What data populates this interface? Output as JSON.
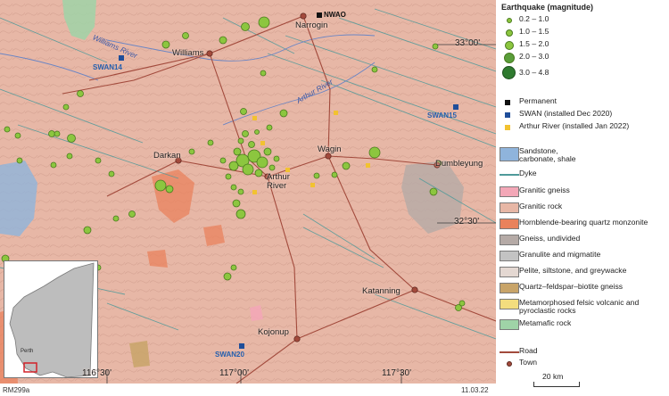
{
  "map": {
    "coordinates": {
      "lat_33_00": "33°00'",
      "lat_32_30": "32°30'",
      "lon_116_30": "116°30'",
      "lon_117_00": "117°00'",
      "lon_117_30": "117°30'"
    },
    "towns": {
      "narrogin": "Narrogin",
      "williams": "Williams",
      "darkan": "Darkan",
      "arthur_river": "Arthur River",
      "wagin": "Wagin",
      "dumbleyung": "Dumbleyung",
      "katanning": "Katanning",
      "kojonup": "Kojonup"
    },
    "rivers": {
      "williams_river": "Williams River",
      "arthur_river": "Arthur River"
    },
    "stations": {
      "nwao": "NWAO",
      "swan14": "SWAN14",
      "swan15": "SWAN15",
      "swan20": "SWAN20"
    },
    "inset": {
      "perth": "Perth"
    }
  },
  "legend": {
    "earthquake_title": "Earthquake (magnitude)",
    "magnitudes": [
      "0.2 – 1.0",
      "1.0 – 1.5",
      "1.5 – 2.0",
      "2.0 – 3.0",
      "3.0 – 4.8"
    ],
    "stations": [
      "Permanent",
      "SWAN (installed Dec 2020)",
      "Arthur River (installed Jan 2022)"
    ],
    "geology": [
      "Sandstone, carbonate, shale",
      "Dyke",
      "Granitic gneiss",
      "Granitic rock",
      "Hornblende-bearing quartz monzonite",
      "Gneiss, undivided",
      "Granulite and migmatite",
      "Pelite, siltstone, and greywacke",
      "Quartz–feldspar–biotite gneiss",
      "Metamorphosed felsic volcanic and pyroclastic rocks",
      "Metamafic rock"
    ],
    "road": "Road",
    "town": "Town",
    "scale": "20 km"
  },
  "colors": {
    "granitic_rock": "#e7b7a6",
    "quake_fill": "#8cc63f",
    "quake_stroke": "#497a1e",
    "permanent": "#111111",
    "swan": "#1f4e9a",
    "arthur_station": "#f2c230",
    "sandstone": "#8fb4dc",
    "dyke": "#4f9a9a",
    "granitic_gneiss": "#f3a7b7",
    "hornblende_monzonite": "#e9825c",
    "gneiss_undivided": "#b5aaa6",
    "granulite": "#c3c3c3",
    "pelite": "#e4d8d2",
    "qfb_gneiss": "#c8a469",
    "felsic_volcanic": "#f3dd7e",
    "metamafic": "#9fd3a7",
    "road": "#a24a3c",
    "town": "#a24a3c"
  },
  "footer": {
    "ref": "RM299a",
    "date": "11.03.22"
  }
}
